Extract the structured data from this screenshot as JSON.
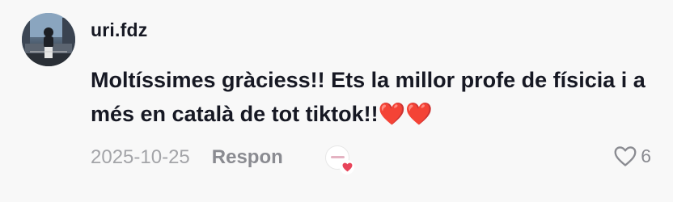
{
  "comment": {
    "username": "uri.fdz",
    "text": "Moltíssimes gràciess!! Ets la millor profe de físicia i a més en català de tot tiktok!!❤️❤️",
    "date": "2025-10-25",
    "reply_label": "Respon",
    "like_count": "6"
  },
  "icons": {
    "avatar": "user-avatar-photo",
    "creator_like": "creator-liked-badge",
    "like": "heart-outline-icon"
  },
  "colors": {
    "text": "#161823",
    "muted": "#a3a4a8",
    "reply": "#8a8b91",
    "like_badge": "#e8445a"
  }
}
